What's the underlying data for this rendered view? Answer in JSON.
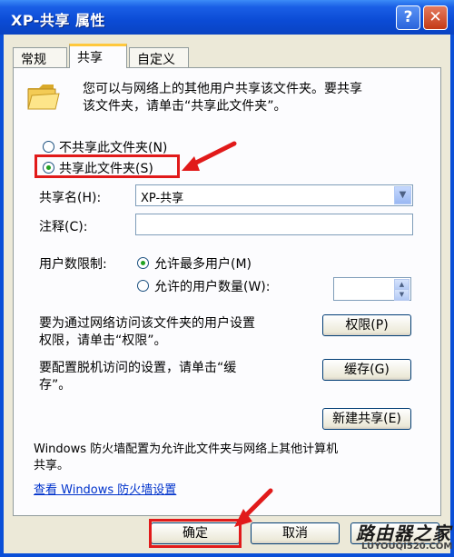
{
  "window": {
    "title": "XP-共享 属性",
    "help_glyph": "?",
    "close_glyph": "✕"
  },
  "tabs": [
    {
      "label": "常规",
      "active": false
    },
    {
      "label": "共享",
      "active": true
    },
    {
      "label": "自定义",
      "active": false
    }
  ],
  "panel": {
    "intro_line1": "您可以与网络上的其他用户共享该文件夹。要共享",
    "intro_line2": "该文件夹，请单击“共享此文件夹”。",
    "radio_not_share": "不共享此文件夹(N)",
    "radio_share": "共享此文件夹(S)",
    "share_name_label": "共享名(H):",
    "share_name_value": "XP-共享",
    "comment_label": "注释(C):",
    "comment_value": "",
    "user_limit_label": "用户数限制:",
    "radio_max_users": "允许最多用户(M)",
    "radio_allowed_users": "允许的用户数量(W):",
    "user_count_value": "",
    "perm_text1": "要为通过网络访问该文件夹的用户设置",
    "perm_text2": "权限，请单击“权限”。",
    "permissions_button": "权限(P)",
    "cache_text1": "要配置脱机访问的设置，请单击“缓",
    "cache_text2": "存”。",
    "caching_button": "缓存(G)",
    "new_share_button": "新建共享(E)",
    "firewall_text1": "Windows 防火墙配置为允许此文件夹与网络上其他计算机",
    "firewall_text2": "共享。",
    "firewall_link": "查看 Windows 防火墙设置"
  },
  "footer": {
    "ok_button": "确定",
    "cancel_button": "取消"
  },
  "watermark": {
    "line1": "路由器之家",
    "line2": "LUYOUQI520.COM"
  },
  "colors": {
    "title_bar": "#0a4fd8",
    "dialog_bg": "#ece9d8",
    "highlight_red": "#e11a1a",
    "link": "#0033cc"
  }
}
